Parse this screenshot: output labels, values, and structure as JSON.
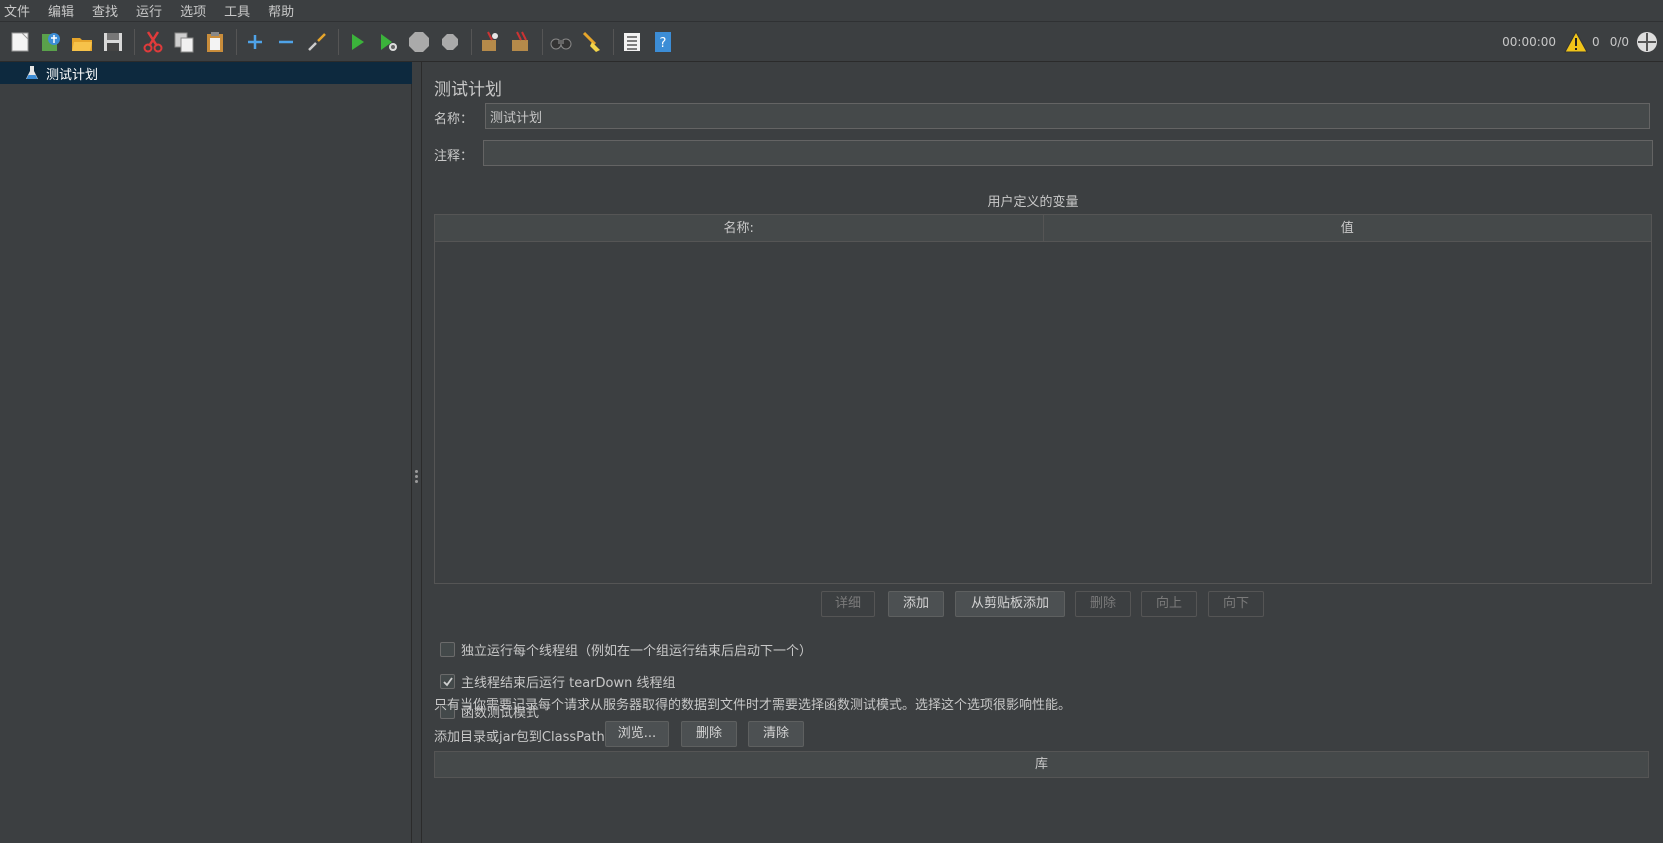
{
  "menu": [
    "文件",
    "编辑",
    "查找",
    "运行",
    "选项",
    "工具",
    "帮助"
  ],
  "toolbar": {
    "icons": [
      "new-icon",
      "templates-icon",
      "open-icon",
      "save-icon",
      "cut-icon",
      "copy-icon",
      "paste-icon",
      "expand-icon",
      "collapse-icon",
      "toggle-icon",
      "start-icon",
      "start-no-pause-icon",
      "stop-icon",
      "shutdown-icon",
      "clear-icon",
      "clear-all-icon",
      "search-icon",
      "reset-search-icon",
      "function-helper-icon",
      "help-icon"
    ],
    "timer": "00:00:00",
    "warning_count": "0",
    "threads": "0/0",
    "colors": {
      "start": "#3bb33b",
      "warning": "#f0c419"
    }
  },
  "tree": {
    "root_label": "测试计划"
  },
  "panel": {
    "title": "测试计划",
    "name_label": "名称：",
    "name_value": "测试计划",
    "comment_label": "注释：",
    "comment_value": "",
    "user_vars_title": "用户定义的变量",
    "table_columns": [
      "名称:",
      "值"
    ],
    "buttons": {
      "detail": "详细",
      "add": "添加",
      "add_clipboard": "从剪贴板添加",
      "delete": "删除",
      "up": "向上",
      "down": "向下"
    },
    "options": {
      "serialize": "独立运行每个线程组（例如在一个组运行结束后启动下一个）",
      "teardown": "主线程结束后运行 tearDown 线程组",
      "functional": "函数测试模式"
    },
    "options_checked": {
      "serialize": false,
      "teardown": true,
      "functional": false
    },
    "functional_note": "只有当你需要记录每个请求从服务器取得的数据到文件时才需要选择函数测试模式。选择这个选项很影响性能。",
    "classpath_label": "添加目录或jar包到ClassPath",
    "cp_buttons": {
      "browse": "浏览...",
      "delete": "删除",
      "clear": "清除"
    },
    "library_header": "库"
  }
}
